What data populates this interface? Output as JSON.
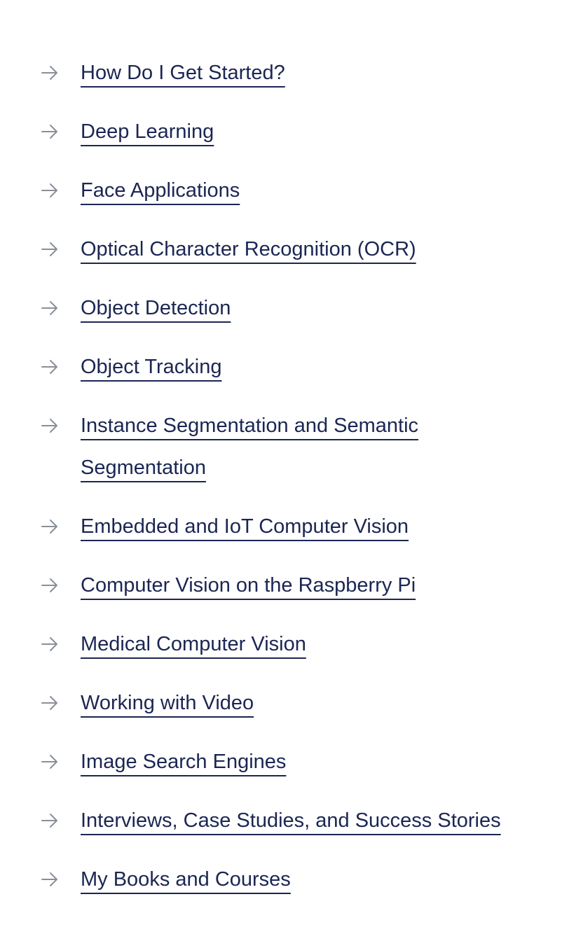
{
  "colors": {
    "link": "#1b2653",
    "arrow": "#8a8f99",
    "background": "#ffffff"
  },
  "topics": [
    {
      "icon": "arrow-right-icon",
      "label": "How Do I Get Started?"
    },
    {
      "icon": "arrow-right-icon",
      "label": "Deep Learning"
    },
    {
      "icon": "arrow-right-icon",
      "label": "Face Applications"
    },
    {
      "icon": "arrow-right-icon",
      "label": "Optical Character Recognition (OCR)"
    },
    {
      "icon": "arrow-right-icon",
      "label": "Object Detection"
    },
    {
      "icon": "arrow-right-icon",
      "label": "Object Tracking"
    },
    {
      "icon": "arrow-right-icon",
      "label": "Instance Segmentation and Semantic Segmentation"
    },
    {
      "icon": "arrow-right-icon",
      "label": "Embedded and IoT Computer Vision"
    },
    {
      "icon": "arrow-right-icon",
      "label": "Computer Vision on the Raspberry Pi"
    },
    {
      "icon": "arrow-right-icon",
      "label": "Medical Computer Vision"
    },
    {
      "icon": "arrow-right-icon",
      "label": "Working with Video"
    },
    {
      "icon": "arrow-right-icon",
      "label": "Image Search Engines"
    },
    {
      "icon": "arrow-right-icon",
      "label": "Interviews, Case Studies, and Success Stories"
    },
    {
      "icon": "arrow-right-icon",
      "label": "My Books and Courses"
    }
  ]
}
